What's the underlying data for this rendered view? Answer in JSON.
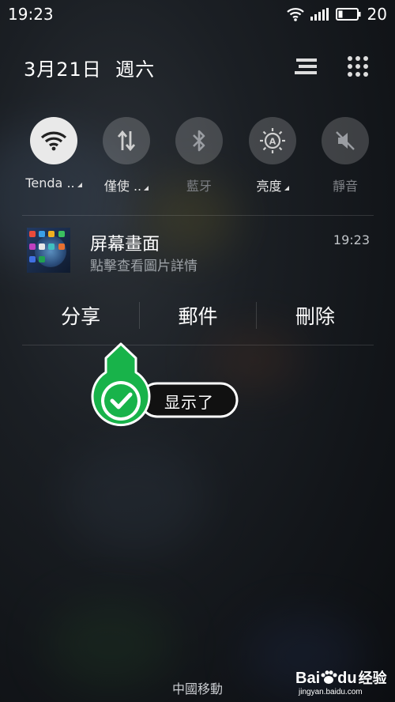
{
  "status_bar": {
    "time": "19:23",
    "battery_level": "20"
  },
  "header": {
    "date": "3月21日  週六"
  },
  "toggles": [
    {
      "label": "Tenda ..",
      "icon": "wifi-icon",
      "state": "on",
      "has_menu": true
    },
    {
      "label": "僅使 ..",
      "icon": "mobile-data-icon",
      "state": "off",
      "has_menu": true
    },
    {
      "label": "藍牙",
      "icon": "bluetooth-icon",
      "state": "off",
      "has_menu": false
    },
    {
      "label": "亮度",
      "icon": "brightness-icon",
      "state": "off",
      "has_menu": true
    },
    {
      "label": "靜音",
      "icon": "mute-icon",
      "state": "off",
      "has_menu": false
    }
  ],
  "notification": {
    "title": "屏幕畫面",
    "subtitle": "點擊查看圖片詳情",
    "time": "19:23"
  },
  "actions": {
    "share": "分享",
    "mail": "郵件",
    "delete": "刪除"
  },
  "overlay": {
    "label": "显示了",
    "accent": "#18b34a"
  },
  "carrier": "中國移動",
  "watermark": {
    "brand": "Bai",
    "brand2": "du",
    "suffix": "经验",
    "url": "jingyan.baidu.com"
  }
}
